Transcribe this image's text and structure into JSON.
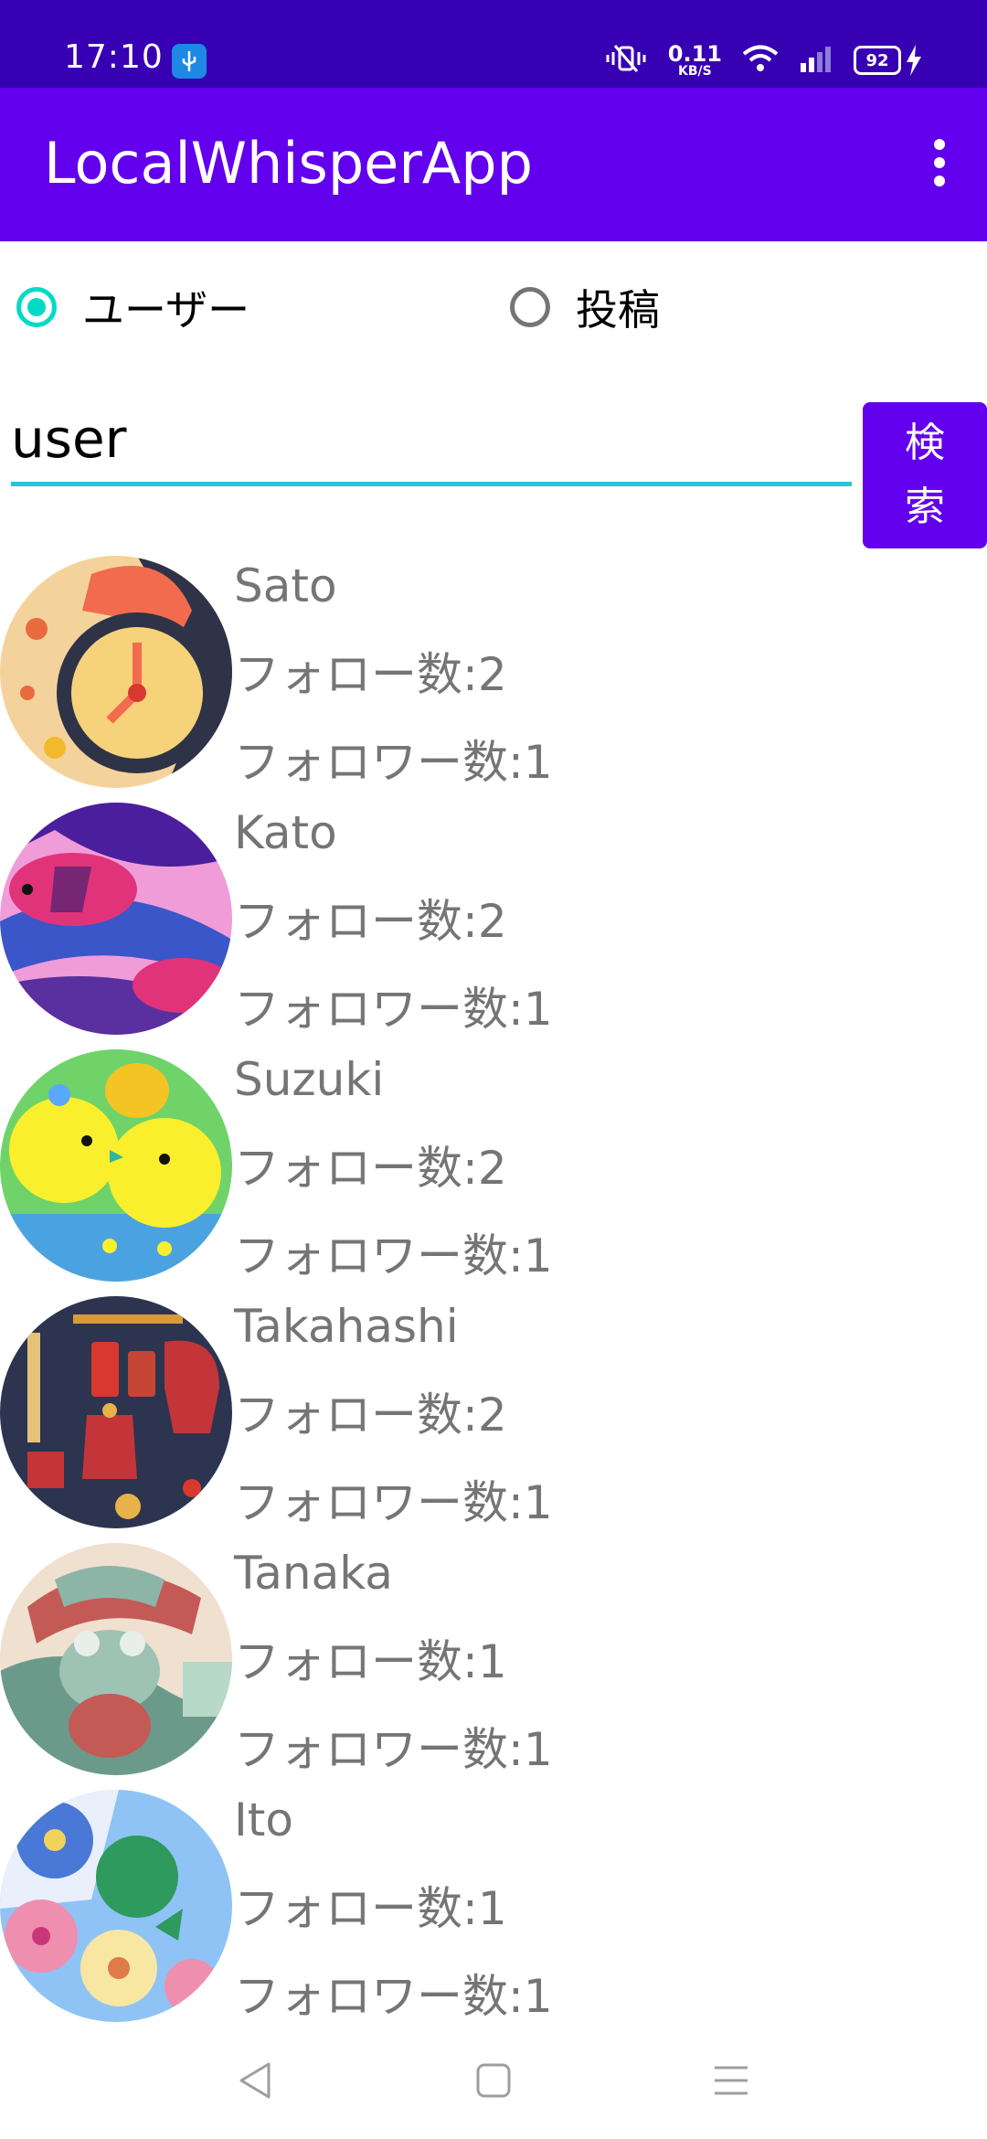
{
  "status_bar": {
    "time": "17:10",
    "net_speed_value": "0.11",
    "net_speed_unit": "KB/S",
    "battery_level": "92",
    "icons": [
      "usb-icon",
      "vibrate-icon",
      "wifi-icon",
      "signal-icon",
      "battery-icon",
      "charging-icon"
    ]
  },
  "app_bar": {
    "title": "LocalWhisperApp",
    "menu_icon": "more-vert-icon"
  },
  "search_type": {
    "options": [
      {
        "label": "ユーザー",
        "checked": true
      },
      {
        "label": "投稿",
        "checked": false
      }
    ]
  },
  "search": {
    "value": "user",
    "button_line1": "検",
    "button_line2": "索"
  },
  "users": [
    {
      "name": "Sato",
      "follow": "フォロー数:2",
      "follower": "フォロワー数:1",
      "avatar": "clock-illustration"
    },
    {
      "name": "Kato",
      "follow": "フォロー数:2",
      "follower": "フォロワー数:1",
      "avatar": "fish-illustration"
    },
    {
      "name": "Suzuki",
      "follow": "フォロー数:2",
      "follower": "フォロワー数:1",
      "avatar": "chicks-illustration"
    },
    {
      "name": "Takahashi",
      "follow": "フォロー数:2",
      "follower": "フォロワー数:1",
      "avatar": "kitchen-illustration"
    },
    {
      "name": "Tanaka",
      "follow": "フォロー数:1",
      "follower": "フォロワー数:1",
      "avatar": "frog-illustration"
    },
    {
      "name": "Ito",
      "follow": "フォロー数:1",
      "follower": "フォロワー数:1",
      "avatar": "flowers-illustration"
    }
  ],
  "nav_bar": {
    "icons": [
      "back-icon",
      "home-icon",
      "recents-icon"
    ]
  },
  "colors": {
    "status_bar": "#3700b3",
    "primary": "#6200ee",
    "accent": "#03dac5",
    "underline": "#26c6da",
    "secondary_text": "#757575"
  }
}
